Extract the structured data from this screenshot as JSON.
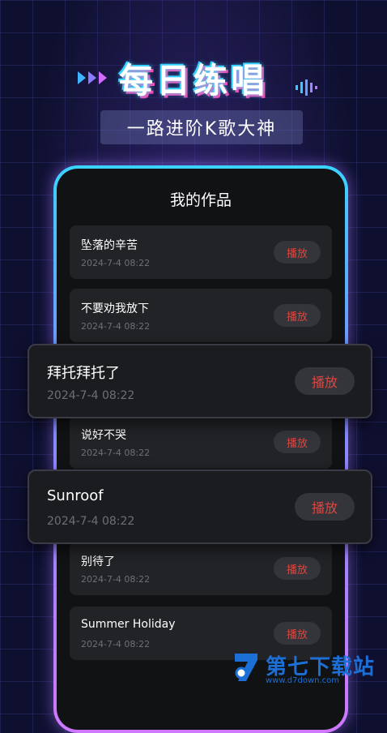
{
  "header": {
    "title": "每日练唱",
    "subtitle": "一路进阶K歌大神"
  },
  "screen": {
    "title": "我的作品",
    "play_label": "播放"
  },
  "works": [
    {
      "name": "坠落的辛苦",
      "time": "2024-7-4   08:22"
    },
    {
      "name": "不要劝我放下",
      "time": "2024-7-4   08:22"
    },
    {
      "name": "拜托拜托了",
      "time": "2024-7-4   08:22"
    },
    {
      "name": "说好不哭",
      "time": "2024-7-4   08:22"
    },
    {
      "name": "Sunroof",
      "time": "2024-7-4   08:22"
    },
    {
      "name": "别待了",
      "time": "2024-7-4   08:22"
    },
    {
      "name": "Summer Holiday",
      "time": "2024-7-4   08:22"
    }
  ],
  "watermark": {
    "name": "第七下载站",
    "url": "www.d7down.com"
  },
  "colors": {
    "play_text": "#e0453f",
    "frame_top": "#3ad4ff",
    "frame_bottom": "#d078ff",
    "accent_pink": "#ff3fae"
  },
  "icons": [
    "arrows-icon",
    "sound-wave-icon",
    "watermark-logo-icon"
  ]
}
